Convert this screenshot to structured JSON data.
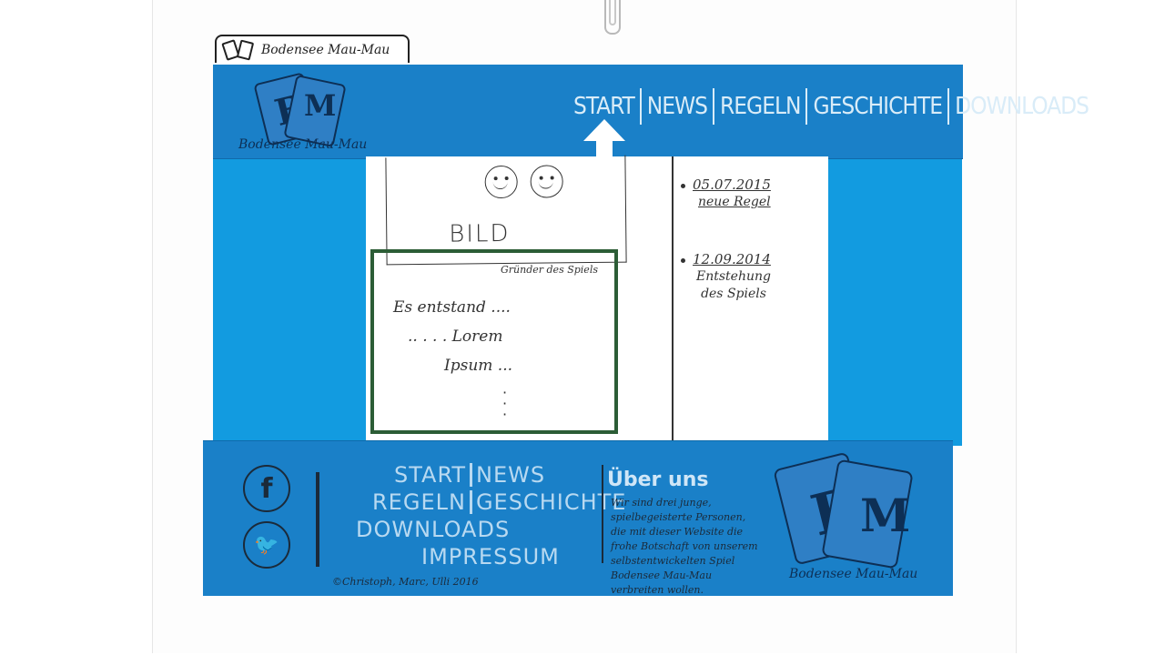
{
  "browser_tab": {
    "title": "Bodensee Mau-Mau"
  },
  "header": {
    "logo_letters": "B",
    "logo_letter2": "M",
    "logo_caption": "Bodensee Mau-Mau",
    "nav": [
      "START",
      "NEWS",
      "REGELN",
      "GESCHICHTE",
      "DOWNLOADS"
    ]
  },
  "main": {
    "image_label": "BILD",
    "image_caption": "Gründer des Spiels",
    "text_lines": [
      "Es entstand ....",
      ".. . . . Lorem",
      "Ipsum ..."
    ]
  },
  "news": [
    {
      "date": "05.07.2015",
      "text": "neue Regel"
    },
    {
      "date": "12.09.2014",
      "text": "Entstehung des Spiels"
    }
  ],
  "footer": {
    "nav_rows": [
      [
        "START",
        "NEWS"
      ],
      [
        "REGELN",
        "GESCHICHTE"
      ],
      [
        "DOWNLOADS"
      ],
      [
        "IMPRESSUM"
      ]
    ],
    "copyright": "©Christoph, Marc, Ulli 2016",
    "about_title": "Über uns",
    "about_text": "Wir sind drei junge, spielbegeisterte Personen, die mit dieser Website die frohe Botschaft von unserem selbstentwickelten Spiel Bodensee Mau-Mau verbreiten wollen.",
    "logo_caption": "Bodensee Mau-Mau",
    "facebook_glyph": "f",
    "twitter_glyph": "🐦"
  },
  "colors": {
    "header_blue": "#1a80c8",
    "side_blue": "#129be0",
    "highlight_green": "#2c5d36"
  }
}
